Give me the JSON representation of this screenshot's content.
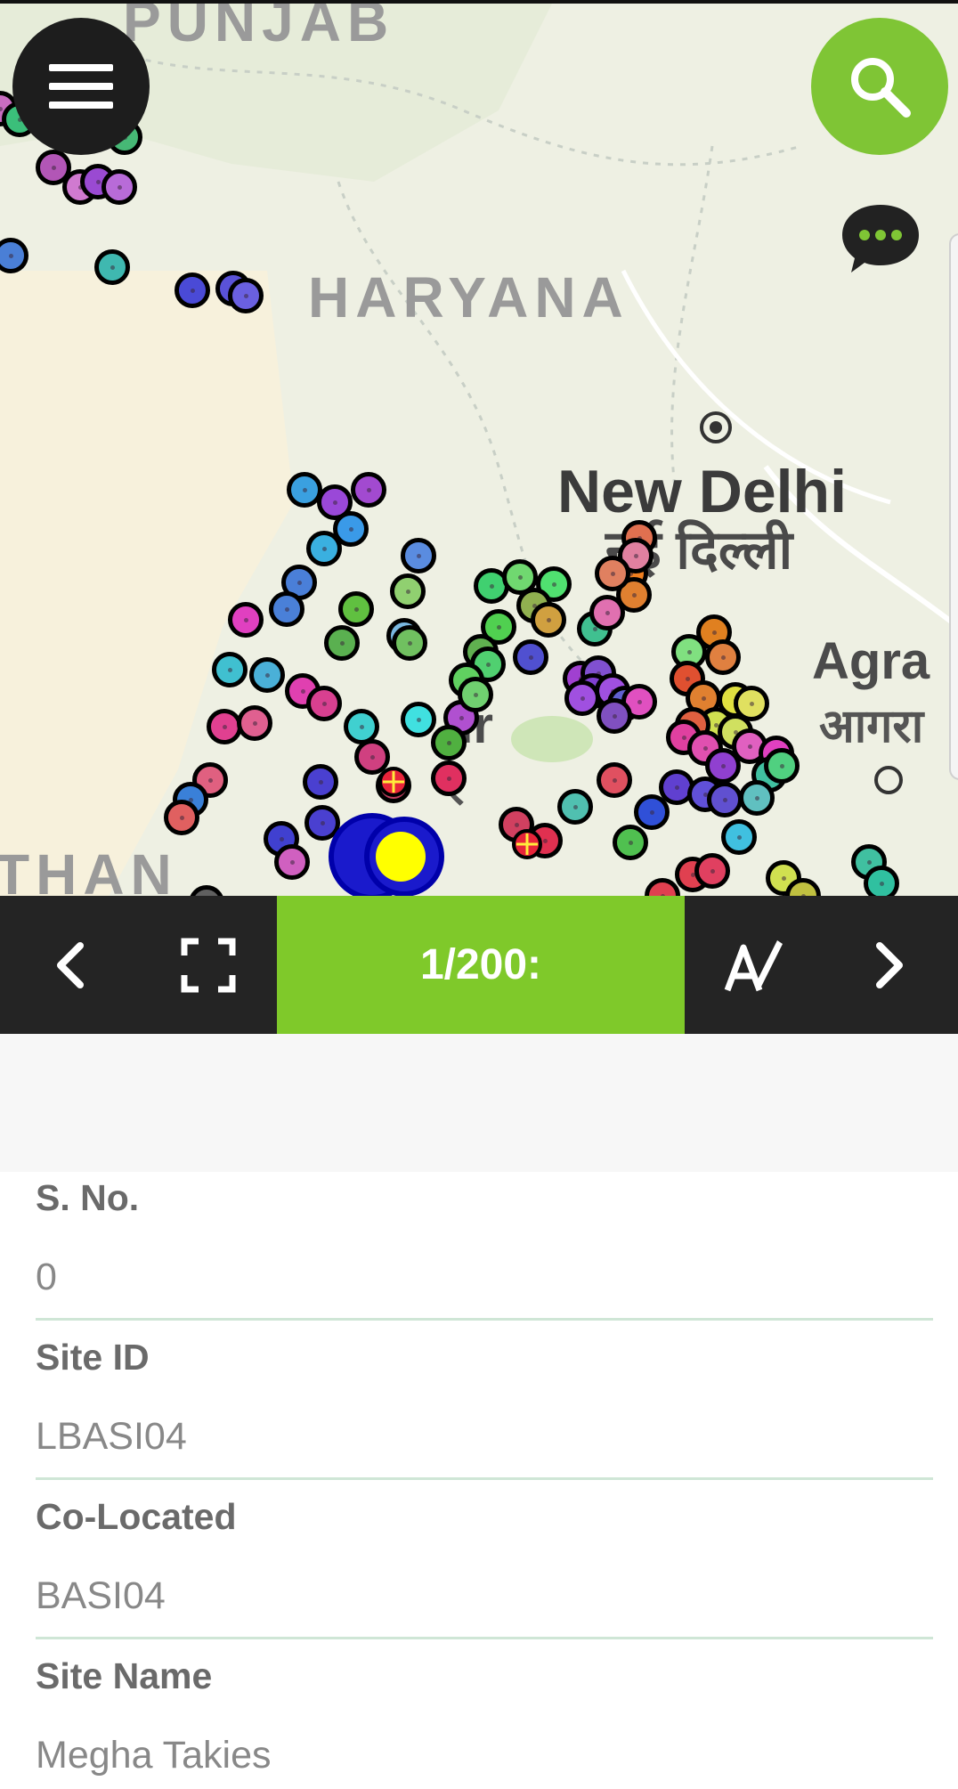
{
  "map": {
    "labels": {
      "region_top": "PUNJAB",
      "region_haryana": "HARYANA",
      "region_bottom": "THAN",
      "city_delhi": "New Delhi",
      "city_delhi_local": "नई दिल्ली",
      "city_agra": "Agra",
      "city_agra_local": "आगरा",
      "city_partial": "ur",
      "city_partial_local": "र"
    },
    "buttons": {
      "menu_icon": "hamburger-menu-icon",
      "search_icon": "search-icon",
      "chat_icon": "chat-bubble-icon"
    },
    "colors": {
      "search_green": "#7fc535",
      "menu_dark": "#1d1d1d"
    }
  },
  "toolbar": {
    "counter": "1/200:",
    "prev_icon": "chevron-left-icon",
    "fullscreen_icon": "fullscreen-icon",
    "edit_icon": "edit-text-icon",
    "next_icon": "chevron-right-icon",
    "accent": "#7fc92a"
  },
  "details": {
    "fields": [
      {
        "label": "S. No.",
        "value": "0"
      },
      {
        "label": "Site ID",
        "value": "LBASI04"
      },
      {
        "label": "Co-Located",
        "value": "BASI04"
      },
      {
        "label": "Site Name",
        "value": "Megha Takies"
      }
    ]
  }
}
